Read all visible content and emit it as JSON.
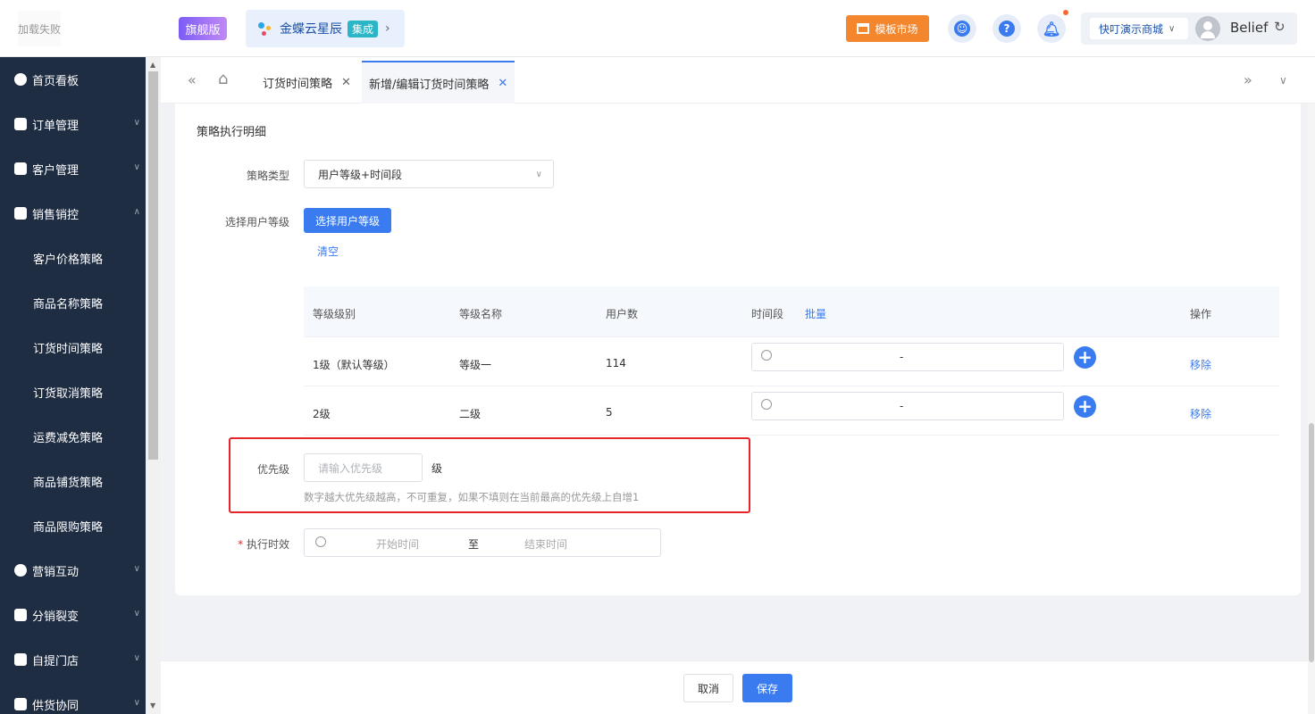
{
  "header": {
    "logo_alt": "加载失败",
    "edition_badge": "旗舰版",
    "brand_name": "金蝶云星辰",
    "brand_tag": "集成",
    "template_market": "模板市场",
    "help_symbol": "?",
    "store_name": "快叮演示商城",
    "username": "Belief",
    "colors": {
      "accent": "#3a7bf0",
      "template": "#f4862d",
      "notify_dot": "#f56c2d"
    }
  },
  "sidebar": {
    "items": [
      {
        "label": "首页看板",
        "icon": "dashboard-icon",
        "expandable": false
      },
      {
        "label": "订单管理",
        "icon": "clipboard-icon",
        "expandable": true
      },
      {
        "label": "客户管理",
        "icon": "user-icon",
        "expandable": true
      },
      {
        "label": "销售销控",
        "icon": "tag-icon",
        "expandable": true,
        "expanded": true
      },
      {
        "label": "客户价格策略",
        "sub": true
      },
      {
        "label": "商品名称策略",
        "sub": true
      },
      {
        "label": "订货时间策略",
        "sub": true
      },
      {
        "label": "订货取消策略",
        "sub": true
      },
      {
        "label": "运费减免策略",
        "sub": true
      },
      {
        "label": "商品铺货策略",
        "sub": true
      },
      {
        "label": "商品限购策略",
        "sub": true
      },
      {
        "label": "营销互动",
        "icon": "target-icon",
        "expandable": true
      },
      {
        "label": "分销裂变",
        "icon": "tree-icon",
        "expandable": true
      },
      {
        "label": "自提门店",
        "icon": "store-icon",
        "expandable": true
      },
      {
        "label": "供货协同",
        "icon": "supply-icon",
        "expandable": true
      }
    ]
  },
  "tabs": [
    {
      "label": "订货时间策略",
      "active": false
    },
    {
      "label": "新增/编辑订货时间策略",
      "active": true
    }
  ],
  "form": {
    "section_title": "策略执行明细",
    "type_label": "策略类型",
    "type_value": "用户等级+时间段",
    "level_label": "选择用户等级",
    "choose_button": "选择用户等级",
    "clear_link": "清空",
    "table": {
      "headers": [
        "等级级别",
        "等级名称",
        "用户数",
        "时间段",
        "批量",
        "操作"
      ],
      "rows": [
        {
          "level": "1级（默认等级）",
          "name": "等级一",
          "users": "114",
          "range_sep": "-",
          "action": "移除"
        },
        {
          "level": "2级",
          "name": "二级",
          "users": "5",
          "range_sep": "-",
          "action": "移除"
        }
      ]
    },
    "priority_label": "优先级",
    "priority_placeholder": "请输入优先级",
    "priority_unit": "级",
    "priority_hint": "数字越大优先级越高，不可重复，如果不填则在当前最高的优先级上自增1",
    "exec_required": "*",
    "exec_label": "执行时效",
    "exec_start": "开始时间",
    "exec_to": "至",
    "exec_end": "结束时间"
  },
  "footer": {
    "cancel": "取消",
    "save": "保存"
  }
}
